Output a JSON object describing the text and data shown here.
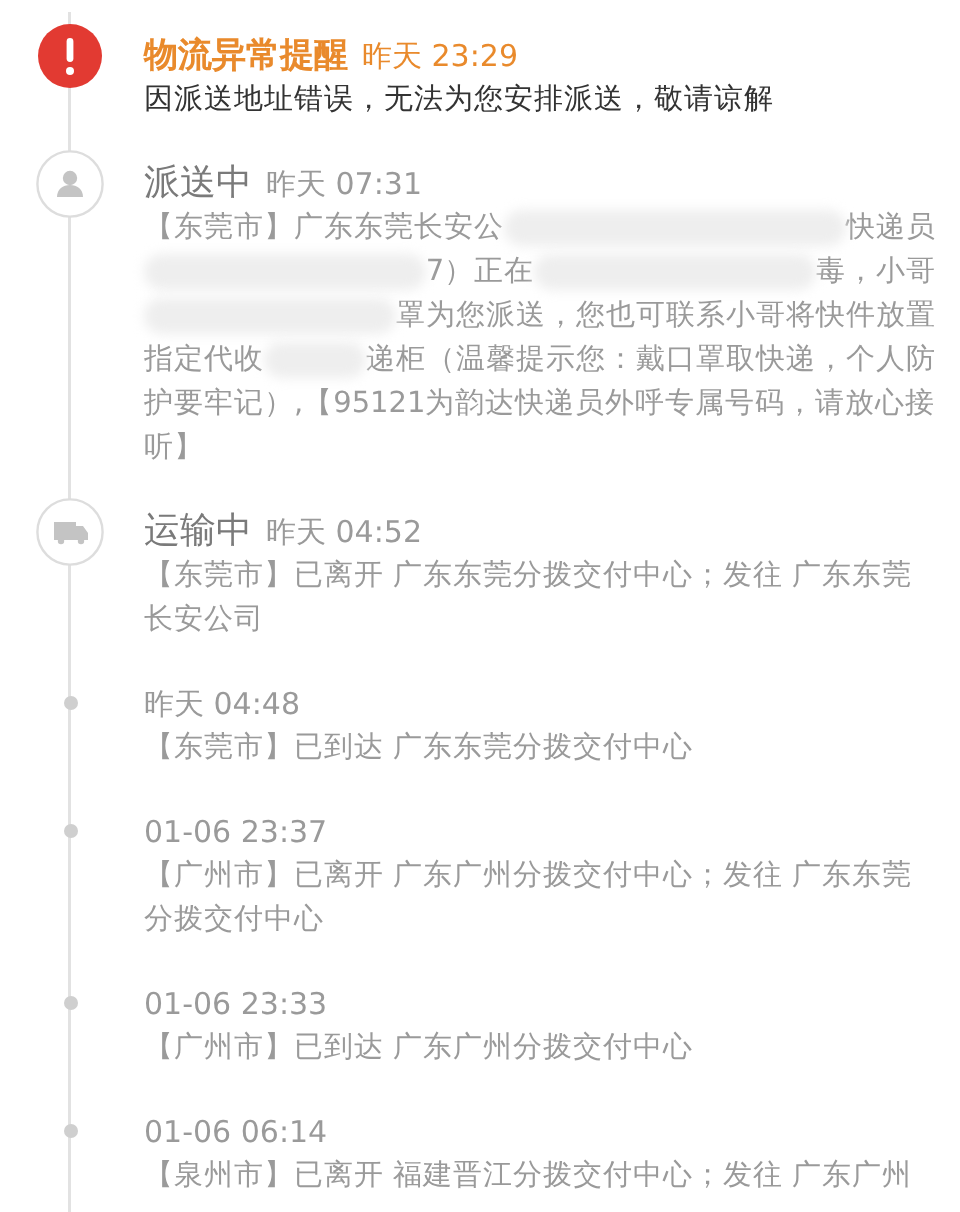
{
  "events": [
    {
      "kind": "alert",
      "title": "物流异常提醒",
      "time": "昨天 23:29",
      "detail": "因派送地址错误，无法为您安排派送，敬请谅解"
    },
    {
      "kind": "delivering",
      "title": "派送中",
      "time": "昨天 07:31",
      "detail_lines": [
        [
          {
            "kind": "text",
            "text": "【东莞市】广东东莞长安公"
          },
          {
            "kind": "blur"
          },
          {
            "kind": "text",
            "text": "快递员"
          }
        ],
        [
          {
            "kind": "blur"
          },
          {
            "kind": "text",
            "text": "7）正在"
          },
          {
            "kind": "blur"
          },
          {
            "kind": "text",
            "text": "毒，小哥"
          }
        ],
        [
          {
            "kind": "blur"
          },
          {
            "kind": "text",
            "text": "罩为您派送，您也可联系小哥将快件放置"
          }
        ],
        [
          {
            "kind": "text",
            "text": "指定代收"
          },
          {
            "kind": "blur"
          },
          {
            "kind": "text",
            "text": "递柜（温馨提示您：戴口罩取快递，个人防"
          }
        ],
        [
          {
            "kind": "text",
            "text": "护要牢记）,【95121为韵达快递员外呼专属号码，请放心接"
          }
        ],
        [
          {
            "kind": "text",
            "text": "听】"
          }
        ]
      ]
    },
    {
      "kind": "transit",
      "title": "运输中",
      "time": "昨天 04:52",
      "detail": "【东莞市】已离开 广东东莞分拨交付中心；发往 广东东莞长安公司"
    },
    {
      "kind": "step",
      "time": "昨天 04:48",
      "detail": "【东莞市】已到达 广东东莞分拨交付中心"
    },
    {
      "kind": "step",
      "time": "01-06 23:37",
      "detail": "【广州市】已离开 广东广州分拨交付中心；发往 广东东莞分拨交付中心"
    },
    {
      "kind": "step",
      "time": "01-06 23:33",
      "detail": "【广州市】已到达 广东广州分拨交付中心"
    },
    {
      "kind": "step",
      "time": "01-06 06:14",
      "detail": "【泉州市】已离开 福建晋江分拨交付中心；发往 广东广州"
    }
  ]
}
